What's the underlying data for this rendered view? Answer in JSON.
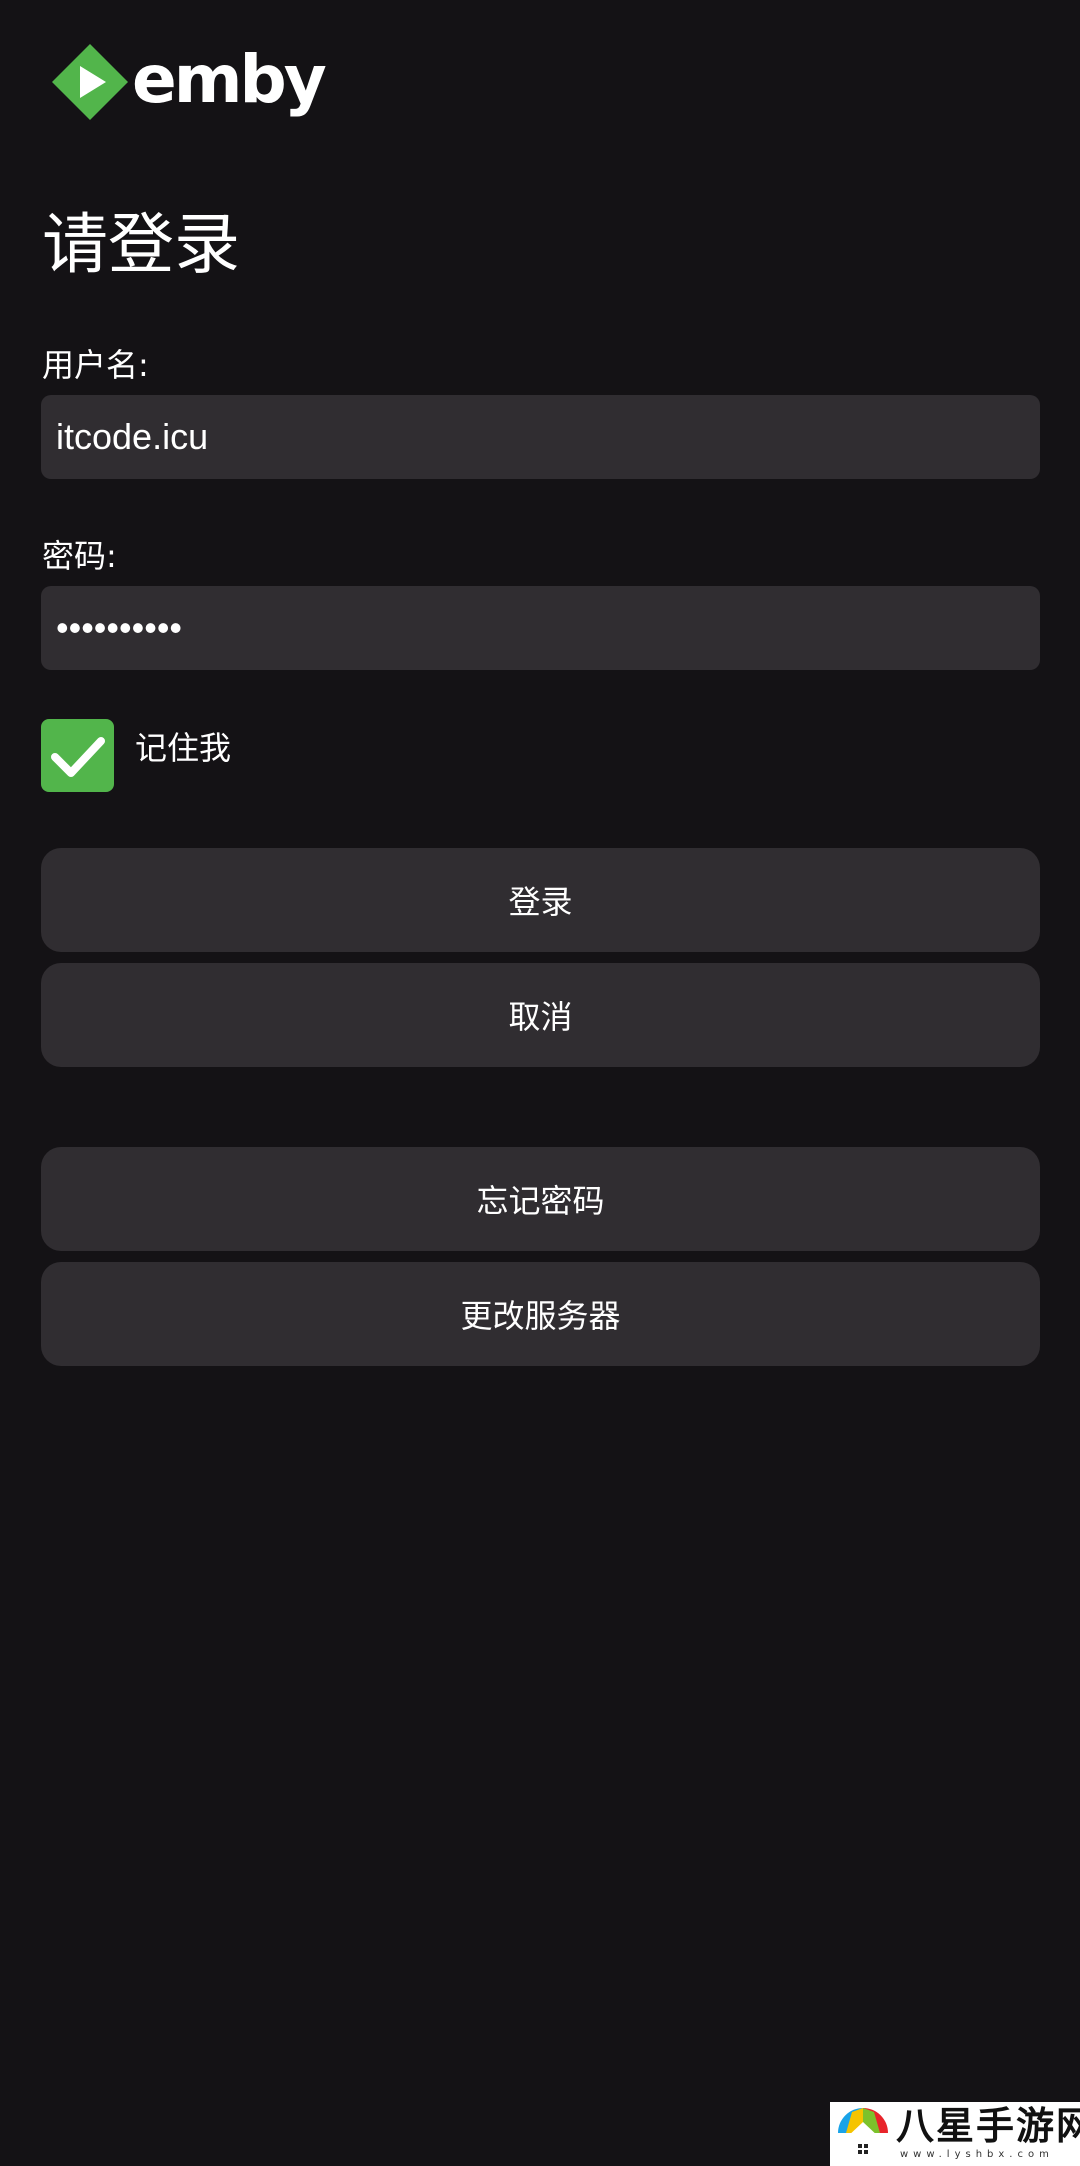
{
  "app": {
    "brand_name": "emby",
    "brand_color": "#52b54b",
    "logo_icon": "emby-logo-icon"
  },
  "page": {
    "title": "请登录"
  },
  "form": {
    "username_label": "用户名:",
    "username_value": "itcode.icu",
    "password_label": "密码:",
    "password_value": "••••••••••",
    "remember_label": "记住我",
    "remember_checked": true
  },
  "buttons": {
    "login": "登录",
    "cancel": "取消",
    "forgot_password": "忘记密码",
    "change_server": "更改服务器"
  },
  "watermark": {
    "text": "八星手游网",
    "subtext": "www.lyshbx.com"
  },
  "colors": {
    "background": "#141215",
    "input_background": "#302d31",
    "button_background": "#302d31",
    "accent": "#52b54b"
  }
}
